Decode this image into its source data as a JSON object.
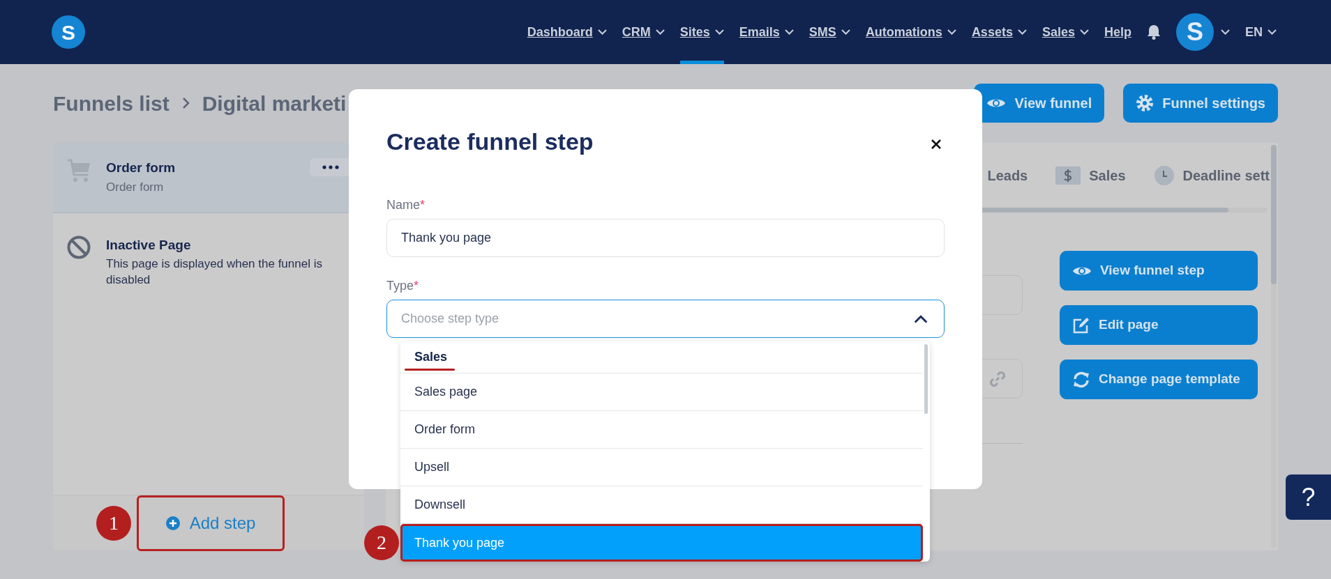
{
  "nav": {
    "logo": "S",
    "items": [
      {
        "label": "Dashboard",
        "dropdown": true,
        "selected": false
      },
      {
        "label": "CRM",
        "dropdown": true,
        "selected": false
      },
      {
        "label": "Sites",
        "dropdown": true,
        "selected": true
      },
      {
        "label": "Emails",
        "dropdown": true,
        "selected": false
      },
      {
        "label": "SMS",
        "dropdown": true,
        "selected": false
      },
      {
        "label": "Automations",
        "dropdown": true,
        "selected": false
      },
      {
        "label": "Assets",
        "dropdown": true,
        "selected": false
      },
      {
        "label": "Sales",
        "dropdown": true,
        "selected": false
      },
      {
        "label": "Help",
        "dropdown": false,
        "selected": false
      }
    ],
    "avatar": "S",
    "language": "EN"
  },
  "breadcrumb": [
    "Funnels list",
    "Digital marketi"
  ],
  "header_buttons": [
    {
      "label": "View funnel"
    },
    {
      "label": "Funnel settings"
    }
  ],
  "steps": [
    {
      "kind": "page",
      "title": "Order form",
      "subtitle": "Order form",
      "selected": true
    },
    {
      "kind": "inactive",
      "title": "Inactive Page",
      "subtitle": "This page is displayed when the funnel is disabled",
      "selected": false
    }
  ],
  "add_step": {
    "label": "Add step",
    "callout": "1"
  },
  "tabs": [
    {
      "label": "Leads"
    },
    {
      "label": "Sales"
    },
    {
      "label": "Deadline sett"
    }
  ],
  "step_actions": [
    {
      "label": "View funnel step"
    },
    {
      "label": "Edit page"
    },
    {
      "label": "Change page template"
    }
  ],
  "help": "?",
  "modal": {
    "title": "Create funnel step",
    "name_field": {
      "label": "Name",
      "required_mark": "*",
      "value": "Thank you page"
    },
    "type_field": {
      "label": "Type",
      "required_mark": "*",
      "placeholder": "Choose step type",
      "expanded": true
    },
    "options": [
      {
        "kind": "group",
        "label": "Sales",
        "underlined": true
      },
      {
        "kind": "option",
        "label": "Sales page",
        "selected": false
      },
      {
        "kind": "option",
        "label": "Order form",
        "selected": false
      },
      {
        "kind": "option",
        "label": "Upsell",
        "selected": false
      },
      {
        "kind": "option",
        "label": "Downsell",
        "selected": false
      },
      {
        "kind": "option",
        "label": "Thank you page",
        "selected": true,
        "callout": "2"
      }
    ]
  }
}
